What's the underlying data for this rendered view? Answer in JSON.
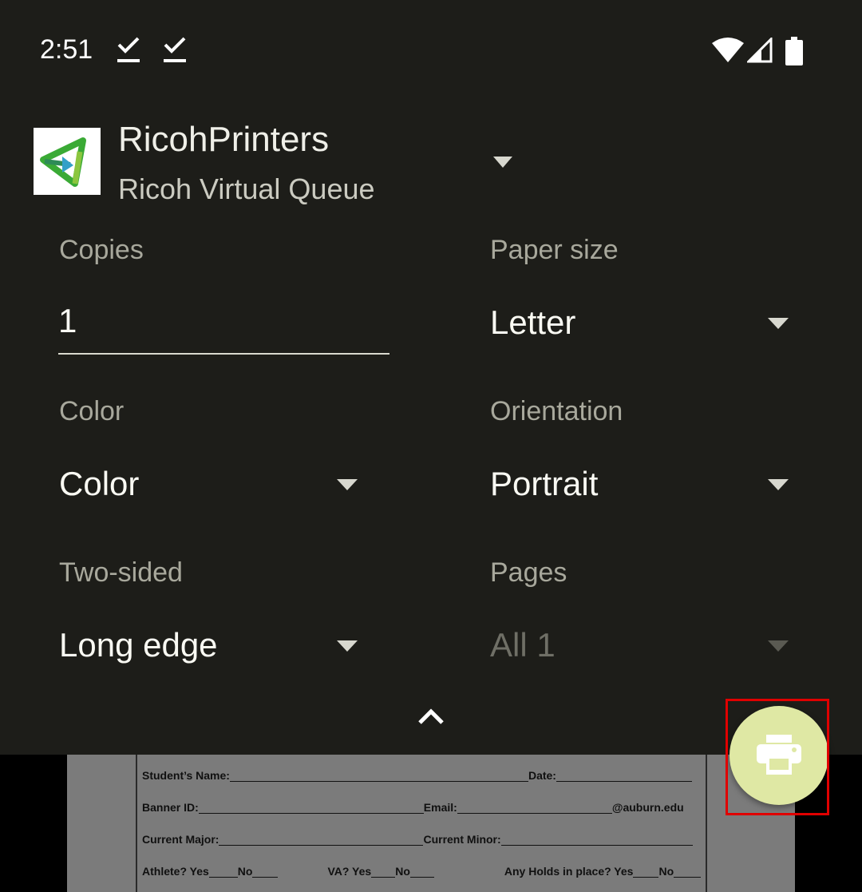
{
  "status_bar": {
    "time": "2:51",
    "left_icons": [
      "checkmark-download-icon",
      "checkmark-download-icon"
    ],
    "right_icons": [
      "wifi-icon",
      "cell-signal-icon",
      "battery-icon"
    ]
  },
  "printer": {
    "name": "RicohPrinters",
    "queue": "Ricoh Virtual Queue",
    "logo_icon": "ricoh-app-logo-icon"
  },
  "options": {
    "copies": {
      "label": "Copies",
      "value": "1"
    },
    "paper_size": {
      "label": "Paper size",
      "value": "Letter"
    },
    "color": {
      "label": "Color",
      "value": "Color"
    },
    "orientation": {
      "label": "Orientation",
      "value": "Portrait"
    },
    "two_sided": {
      "label": "Two-sided",
      "value": "Long edge"
    },
    "pages": {
      "label": "Pages",
      "value": "All 1",
      "disabled": true
    }
  },
  "controls": {
    "collapse_icon": "chevron-up-icon",
    "print_icon": "printer-icon",
    "fab_color": "#dfe8a4",
    "highlight_color": "#e00000"
  },
  "preview": {
    "line1": {
      "name": "Student’s Name:",
      "date": "Date:"
    },
    "line2": {
      "banner": "Banner ID:",
      "email": "Email:",
      "domain": "@auburn.edu"
    },
    "line3": {
      "major": "Current Major:",
      "minor": "Current Minor:"
    },
    "line4": {
      "athlete": "Athlete? Yes",
      "no1": "No",
      "va": "VA? Yes",
      "no2": "No",
      "holds": "Any Holds in place? Yes",
      "no3": "No"
    }
  }
}
